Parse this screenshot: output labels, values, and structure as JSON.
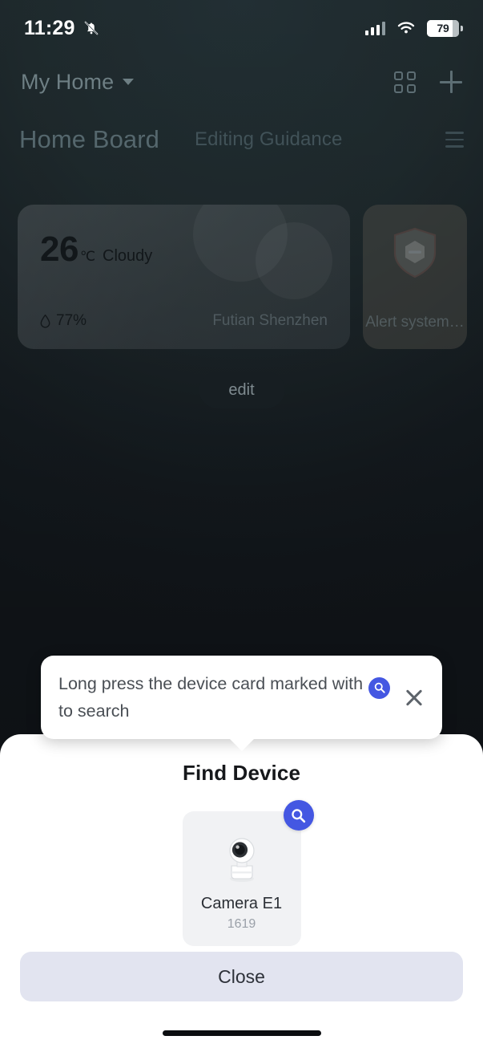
{
  "status_bar": {
    "time": "11:29",
    "mute_icon": "bell-slash-icon",
    "signal_icon": "cellular-signal-icon",
    "wifi_icon": "wifi-icon",
    "battery_percent": "79"
  },
  "app_header": {
    "home_name": "My Home",
    "caret_icon": "chevron-down-icon",
    "grid_icon": "grid-view-icon",
    "add_icon": "plus-icon"
  },
  "tabs": {
    "active": "Home Board",
    "secondary": "Editing Guidance",
    "menu_icon": "hamburger-menu-icon"
  },
  "weather_card": {
    "temperature": "26",
    "unit": "℃",
    "condition": "Cloudy",
    "humidity": "77%",
    "humidity_icon": "water-drop-icon",
    "location": "Futian Shenzhen"
  },
  "alert_card": {
    "icon": "shield-disarmed-icon",
    "label": "Alert system…"
  },
  "edit_button": {
    "label": "edit"
  },
  "tooltip": {
    "text_before": "Long press the device card marked with",
    "inline_icon": "search-icon",
    "text_after": "to search",
    "close_icon": "close-icon"
  },
  "sheet": {
    "title": "Find Device",
    "device": {
      "name": "Camera E1",
      "id": "1619",
      "icon": "security-camera-icon",
      "badge_icon": "search-icon"
    },
    "close_label": "Close"
  },
  "colors": {
    "accent_blue": "#4457e2",
    "sheet_background": "#ffffff",
    "device_card_background": "#f1f2f4",
    "close_button_background": "#e2e4f0",
    "backdrop_top": "#2b3c42",
    "backdrop_bottom": "#171d23"
  }
}
